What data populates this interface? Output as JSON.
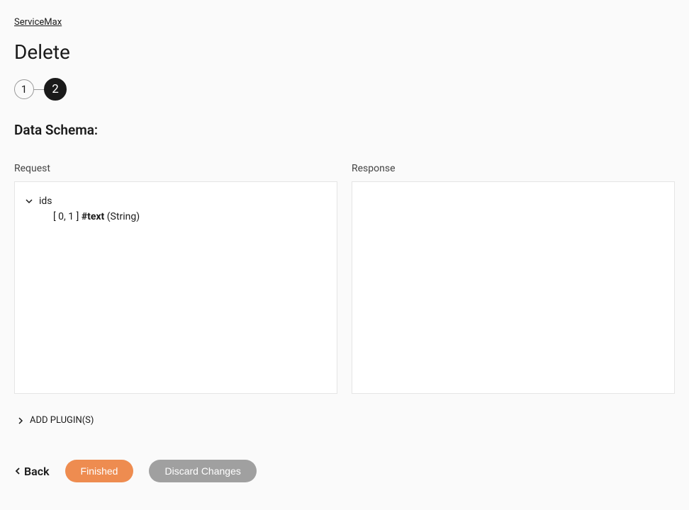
{
  "breadcrumb": "ServiceMax",
  "pageTitle": "Delete",
  "stepper": {
    "step1": "1",
    "step2": "2"
  },
  "sectionTitle": "Data Schema:",
  "request": {
    "label": "Request",
    "tree": {
      "root": "ids",
      "childRange": "[ 0, 1 ]",
      "childName": "#text",
      "childType": "(String)"
    }
  },
  "response": {
    "label": "Response"
  },
  "pluginToggle": "ADD PLUGIN(S)",
  "footer": {
    "back": "Back",
    "finished": "Finished",
    "discard": "Discard Changes"
  }
}
